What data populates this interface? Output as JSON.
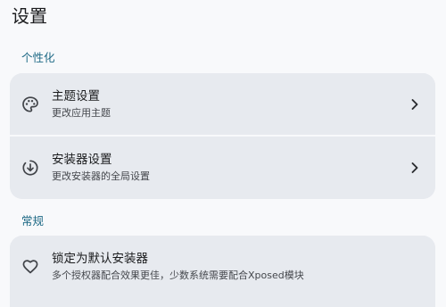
{
  "header": {
    "title": "设置"
  },
  "sections": [
    {
      "label": "个性化",
      "items": [
        {
          "title": "主题设置",
          "subtitle": "更改应用主题",
          "icon": "palette-icon"
        },
        {
          "title": "安装器设置",
          "subtitle": "更改安装器的全局设置",
          "icon": "download-circle-icon"
        }
      ]
    },
    {
      "label": "常规",
      "items": [
        {
          "title": "锁定为默认安装器",
          "subtitle": "多个授权器配合效果更佳，少数系统需要配合Xposed模块",
          "icon": "heart-icon"
        }
      ]
    }
  ],
  "colors": {
    "background": "#f8f9fb",
    "card": "#e7eaef",
    "accent": "#1f6a86",
    "text": "#1b1c1e",
    "subtext": "#44474c"
  }
}
